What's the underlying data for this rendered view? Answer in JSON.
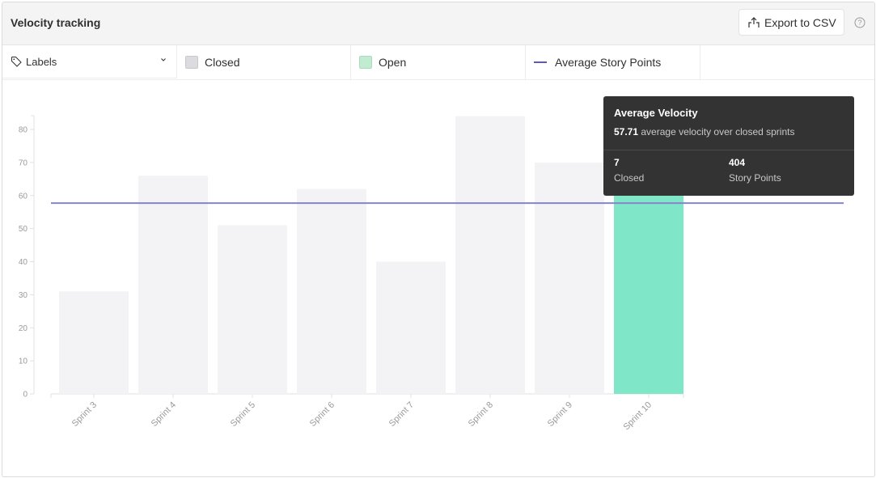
{
  "header": {
    "title": "Velocity tracking",
    "export_label": "Export to CSV",
    "export_icon": "export-icon",
    "help_icon": "help-circle-icon"
  },
  "legend": {
    "labels_dropdown": {
      "label": "Labels",
      "icon": "tag-icon"
    },
    "closed_label": "Closed",
    "open_label": "Open",
    "avg_label": "Average Story Points",
    "colors": {
      "closed": "#f3f3f5",
      "open": "#80e6c8",
      "average": "#8585c8"
    }
  },
  "tooltip": {
    "title": "Average Velocity",
    "value": "57.71",
    "value_desc": "average velocity over closed sprints",
    "stats": [
      {
        "value": "7",
        "label": "Closed"
      },
      {
        "value": "404",
        "label": "Story Points"
      }
    ]
  },
  "chart_data": {
    "type": "bar",
    "title": "Velocity tracking",
    "xlabel": "",
    "ylabel": "",
    "ylim": [
      0,
      80
    ],
    "yticks": [
      0,
      10,
      20,
      30,
      40,
      50,
      60,
      70,
      80
    ],
    "categories": [
      "Sprint 3",
      "Sprint 4",
      "Sprint 5",
      "Sprint 6",
      "Sprint 7",
      "Sprint 8",
      "Sprint 9",
      "Sprint 10"
    ],
    "series": [
      {
        "name": "Closed",
        "values": [
          31,
          66,
          51,
          62,
          40,
          84,
          70,
          null
        ]
      },
      {
        "name": "Open",
        "values": [
          null,
          null,
          null,
          null,
          null,
          null,
          null,
          66
        ]
      }
    ],
    "average_line": {
      "name": "Average Story Points",
      "value": 57.71
    },
    "grid": false,
    "legend_position": "top"
  }
}
